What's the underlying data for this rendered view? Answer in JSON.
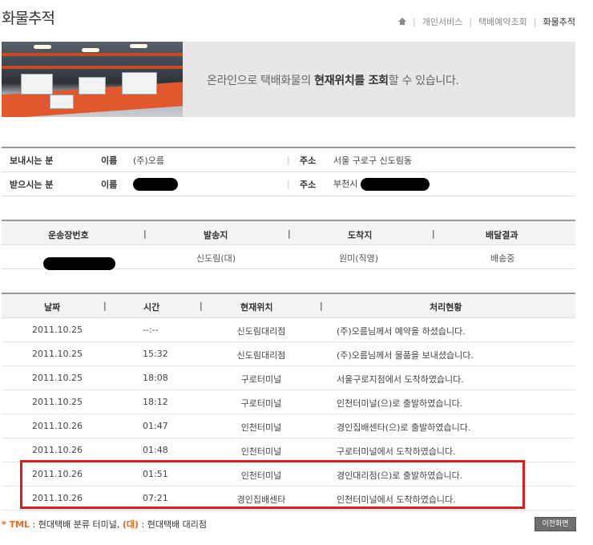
{
  "page": {
    "title": "화물추적"
  },
  "breadcrumb": {
    "home": "⌂",
    "items": [
      "개인서비스",
      "택배예약조회",
      "화물추적"
    ]
  },
  "banner": {
    "text_before": "온라인으로 택배화물의 ",
    "text_bold": "현재위치를 조회",
    "text_after": "할 수 있습니다."
  },
  "parties": {
    "sender": {
      "label": "보내시는 분",
      "name_label": "이름",
      "name": "(주)오름",
      "addr_label": "주소",
      "address": "서울 구로구 신도림동"
    },
    "receiver": {
      "label": "받으시는 분",
      "name_label": "이름",
      "name": "",
      "addr_label": "주소",
      "address": "부천시"
    }
  },
  "shipment": {
    "headers": [
      "운송장번호",
      "발송지",
      "도착지",
      "배달결과"
    ],
    "row": {
      "tracking_no": "",
      "origin": "신도림(대)",
      "destination": "원미(직영)",
      "result": "배송중"
    }
  },
  "tracking": {
    "headers": [
      "날짜",
      "시간",
      "현재위치",
      "처리현황"
    ],
    "rows": [
      {
        "date": "2011.10.25",
        "time": "--:--",
        "location": "신도림대리점",
        "status": "(주)오름님께서 예약을 하셨습니다."
      },
      {
        "date": "2011.10.25",
        "time": "15:32",
        "location": "신도림대리점",
        "status": "(주)오름님께서 물품을 보내셨습니다."
      },
      {
        "date": "2011.10.25",
        "time": "18:08",
        "location": "구로터미널",
        "status": "서울구로지점에서 도착하였습니다."
      },
      {
        "date": "2011.10.25",
        "time": "18:12",
        "location": "구로터미널",
        "status": "인천터미널(으)로 출발하였습니다."
      },
      {
        "date": "2011.10.26",
        "time": "01:47",
        "location": "인천터미널",
        "status": "경인집배센타(으)로 출발하였습니다."
      },
      {
        "date": "2011.10.26",
        "time": "01:48",
        "location": "인천터미널",
        "status": "구로터미널에서 도착하였습니다."
      },
      {
        "date": "2011.10.26",
        "time": "01:51",
        "location": "인천터미널",
        "status": "경인대리점(으)로 출발하였습니다."
      },
      {
        "date": "2011.10.26",
        "time": "07:21",
        "location": "경인집배센타",
        "status": "인천터미널에서 도착하였습니다."
      }
    ]
  },
  "legend": {
    "tml_key": "* TML",
    "tml_desc": " : 현대택배 분류 터미널, ",
    "dae_key": "(대)",
    "dae_desc": " : 현대택배 대리점"
  },
  "buttons": {
    "back": "이전화면"
  },
  "colors": {
    "highlight": "#e01b1b",
    "accent": "#e36b1b"
  }
}
